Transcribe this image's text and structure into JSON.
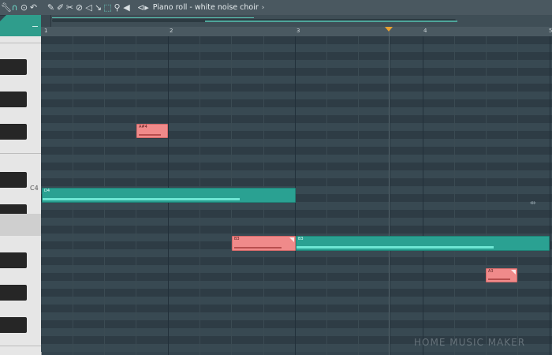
{
  "toolbar": {
    "title": "Piano roll - white noise choir",
    "title_arrow": "⊲▸",
    "title_chevron": "›"
  },
  "ruler": {
    "bars": [
      "2",
      "3",
      "4"
    ]
  },
  "keyboard": {
    "c4_label": "C4"
  },
  "notes": [
    {
      "label": "A#4",
      "color": "red"
    },
    {
      "label": "D4",
      "color": "green"
    },
    {
      "label": "B3",
      "color": "red"
    },
    {
      "label": "B3",
      "color": "green"
    },
    {
      "label": "A3",
      "color": "red"
    }
  ],
  "watermark": "HOME MUSIC MAKER",
  "colors": {
    "grid_bg": "#34444e",
    "note_red": "#f08a8a",
    "note_green": "#2aa192",
    "playhead": "#e8a030",
    "accent": "#2f9d8c"
  }
}
